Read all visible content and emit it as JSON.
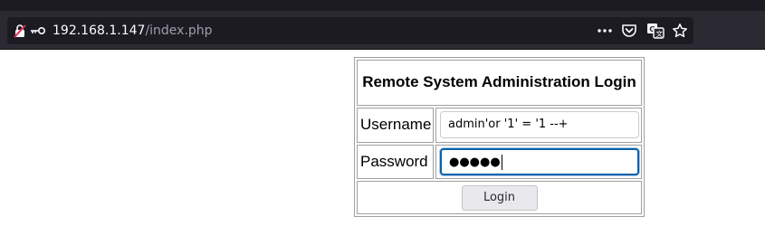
{
  "browser": {
    "url_host": "192.168.1.147",
    "url_path": "/index.php",
    "icons": {
      "insecure": "insecure-connection-icon",
      "key": "key-icon",
      "more": "more-options-icon",
      "pocket": "pocket-icon",
      "translate": "translate-icon",
      "bookmark": "bookmark-star-icon"
    }
  },
  "form": {
    "title": "Remote System Administration Login",
    "username_label": "Username",
    "username_value": "admin'or '1' = '1 --+",
    "password_label": "Password",
    "password_mask": "●●●●●",
    "login_label": "Login"
  }
}
